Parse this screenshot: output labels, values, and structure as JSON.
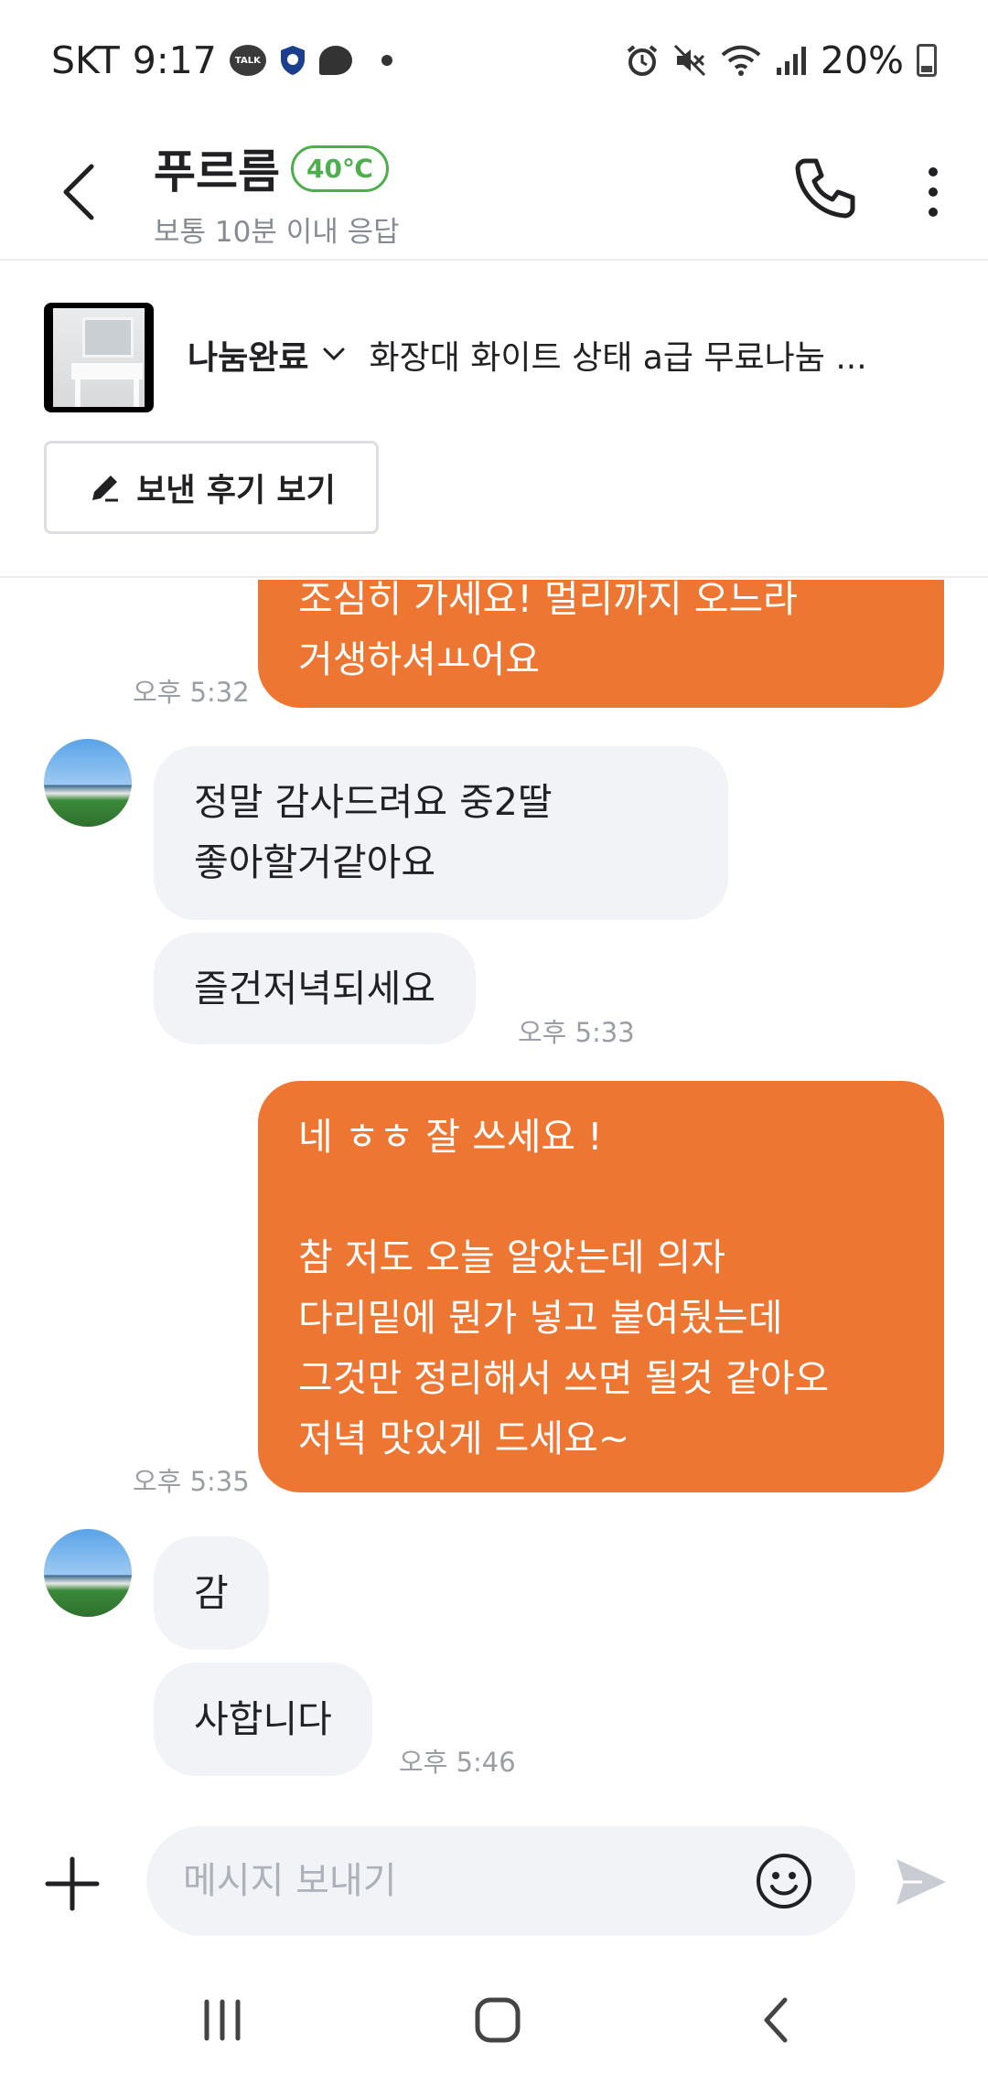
{
  "status_bar": {
    "carrier": "SKT",
    "time": "9:17",
    "talk_badge": "TALK",
    "battery": "20%"
  },
  "header": {
    "name": "푸르름",
    "temperature": "40℃",
    "response": "보통 10분 이내 응답"
  },
  "product": {
    "status": "나눔완료",
    "title": "화장대 화이트 상태 a급 무료나눔 ...",
    "review_button": "보낸 후기 보기"
  },
  "messages": [
    {
      "from": "me",
      "lines": [
        "조심히 가세요! 멀리까지 오느라",
        "거생하셔ㅛ어요"
      ],
      "time": "오후 5:32"
    },
    {
      "from": "them",
      "lines": [
        "정말 감사드려요 중2딸",
        "좋아할거같아요"
      ]
    },
    {
      "from": "them",
      "lines": [
        "즐건저녁되세요"
      ],
      "time": "오후 5:33"
    },
    {
      "from": "me",
      "lines": [
        "네 ㅎㅎ 잘 쓰세요 !",
        "",
        "참 저도 오늘 알았는데 의자",
        "다리밑에 뭔가 넣고 붙여뒀는데",
        "그것만 정리해서 쓰면 될것 같아오",
        "저녁 맛있게 드세요~"
      ],
      "time": "오후 5:35"
    },
    {
      "from": "them",
      "lines": [
        "감"
      ]
    },
    {
      "from": "them",
      "lines": [
        "사합니다"
      ],
      "time": "오후 5:46"
    }
  ],
  "input": {
    "placeholder": "메시지 보내기"
  },
  "colors": {
    "accent": "#ee7633",
    "temperature": "#4cae4c",
    "bubble_other": "#f2f3f6"
  },
  "icons": {
    "back": "back-arrow-icon",
    "call": "phone-icon",
    "more": "more-vertical-icon",
    "plus": "plus-icon",
    "emoji": "emoji-icon",
    "send": "send-icon"
  }
}
